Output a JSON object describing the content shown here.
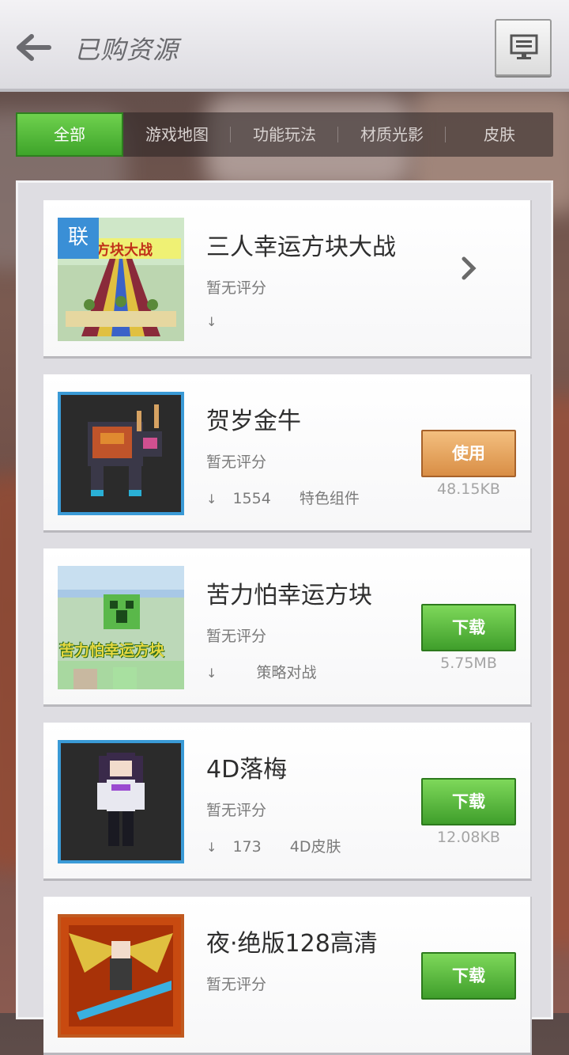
{
  "header": {
    "title": "已购资源",
    "back_icon": "back-arrow-icon",
    "menu_icon": "monitor-icon"
  },
  "tabs": [
    {
      "label": "全部",
      "active": true
    },
    {
      "label": "游戏地图",
      "active": false
    },
    {
      "label": "功能玩法",
      "active": false
    },
    {
      "label": "材质光影",
      "active": false
    },
    {
      "label": "皮肤",
      "active": false
    }
  ],
  "items": [
    {
      "title": "三人幸运方块大战",
      "rating": "暂无评分",
      "downloads": "",
      "category": "",
      "action": "",
      "size": "",
      "badge": "联",
      "thumb_text": "幸运方块大战"
    },
    {
      "title": "贺岁金牛",
      "rating": "暂无评分",
      "downloads": "1554",
      "category": "特色组件",
      "action": "使用",
      "size": "48.15KB"
    },
    {
      "title": "苦力怕幸运方块",
      "rating": "暂无评分",
      "downloads": "",
      "category": "策略对战",
      "action": "下载",
      "size": "5.75MB",
      "thumb_text": "苦力怕幸运方块"
    },
    {
      "title": "4D落梅",
      "rating": "暂无评分",
      "downloads": "173",
      "category": "4D皮肤",
      "action": "下载",
      "size": "12.08KB"
    },
    {
      "title": "夜·绝版128高清",
      "rating": "暂无评分",
      "downloads": "",
      "category": "",
      "action": "下载",
      "size": ""
    }
  ],
  "colors": {
    "green": "#4caf38",
    "orange": "#e09a50",
    "frame_blue": "#3a9ad6"
  }
}
